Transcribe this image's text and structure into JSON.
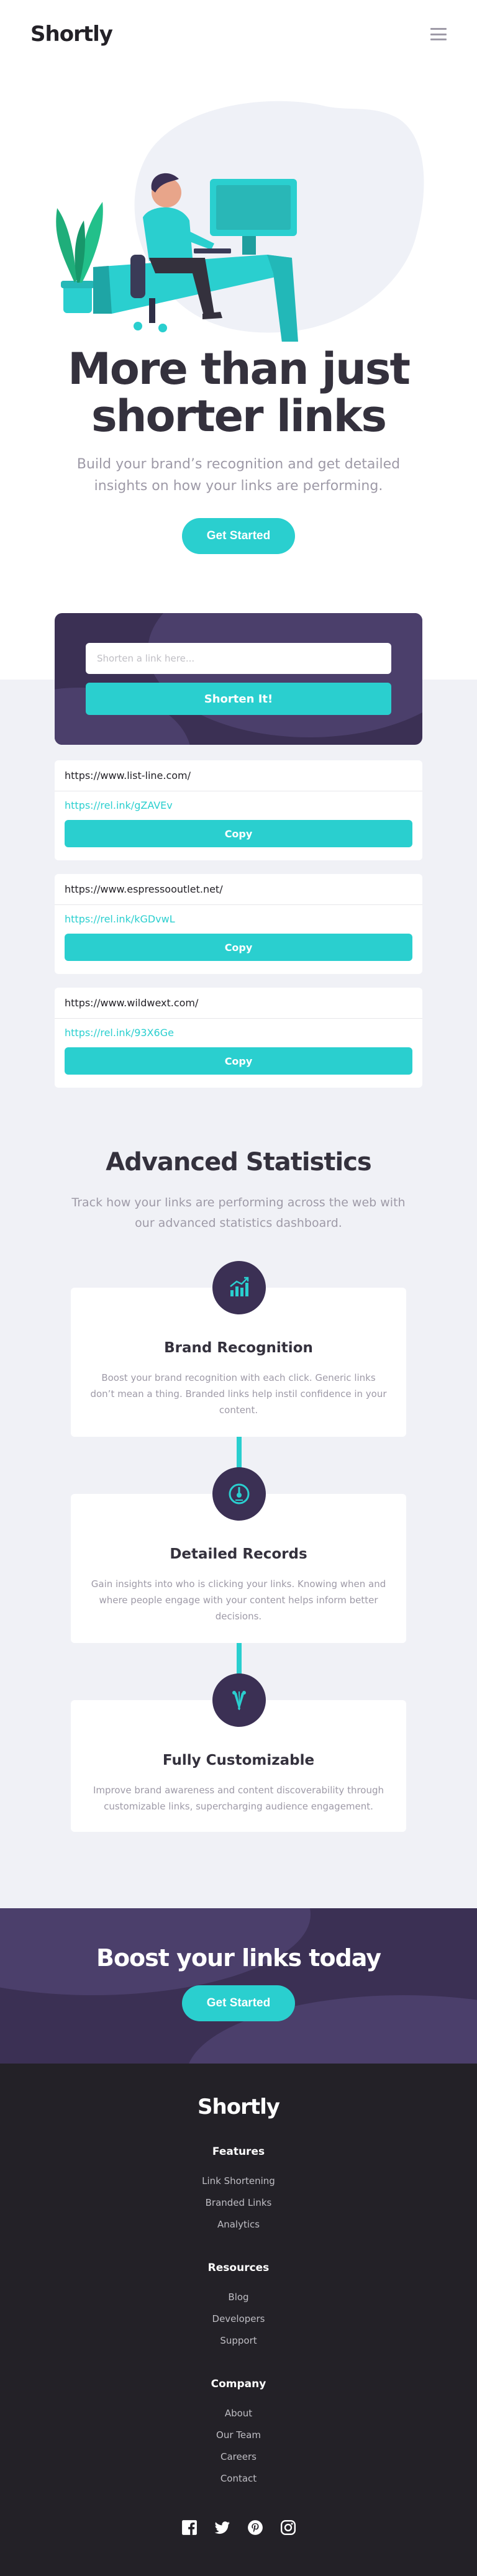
{
  "header": {
    "logo": "Shortly",
    "menu_icon": "hamburger-menu-icon"
  },
  "hero": {
    "title_line1": "More than just",
    "title_line2": "shorter links",
    "subtitle": "Build your brand’s recognition and get detailed insights on how your links are performing.",
    "cta": "Get Started",
    "illustration": "person-working-at-desk-illustration"
  },
  "shorten": {
    "placeholder": "Shorten a link here...",
    "button": "Shorten It!"
  },
  "links": [
    {
      "original": "https://www.list-line.com/",
      "short": "https://rel.ink/gZAVEv",
      "copy_label": "Copy"
    },
    {
      "original": "https://www.espressooutlet.net/",
      "short": "https://rel.ink/kGDvwL",
      "copy_label": "Copy"
    },
    {
      "original": "https://www.wildwext.com/",
      "short": "https://rel.ink/93X6Ge",
      "copy_label": "Copy"
    }
  ],
  "stats": {
    "title": "Advanced Statistics",
    "subtitle": "Track how your links are performing across the web with our advanced statistics dashboard.",
    "features": [
      {
        "icon": "bar-chart-icon",
        "title": "Brand Recognition",
        "text": "Boost your brand recognition with each click. Generic links don’t mean a thing. Branded links help instil confidence in your content."
      },
      {
        "icon": "gauge-icon",
        "title": "Detailed Records",
        "text": "Gain insights into who is clicking your links. Knowing when and where people engage with your content helps inform better decisions."
      },
      {
        "icon": "paint-brushes-icon",
        "title": "Fully Customizable",
        "text": "Improve brand awareness and content discoverability through customizable links, supercharging audience engagement."
      }
    ]
  },
  "boost": {
    "title": "Boost your links today",
    "cta": "Get Started"
  },
  "footer": {
    "logo": "Shortly",
    "columns": [
      {
        "title": "Features",
        "links": [
          "Link Shortening",
          "Branded Links",
          "Analytics"
        ]
      },
      {
        "title": "Resources",
        "links": [
          "Blog",
          "Developers",
          "Support"
        ]
      },
      {
        "title": "Company",
        "links": [
          "About",
          "Our Team",
          "Careers",
          "Contact"
        ]
      }
    ],
    "socials": [
      "facebook-icon",
      "twitter-icon",
      "pinterest-icon",
      "instagram-icon"
    ]
  },
  "colors": {
    "cyan": "#2acfcf",
    "dark_violet": "#3b3054",
    "very_dark_violet": "#232127",
    "gray": "#9e9aa7",
    "light_gray_bg": "#f0f1f6"
  }
}
